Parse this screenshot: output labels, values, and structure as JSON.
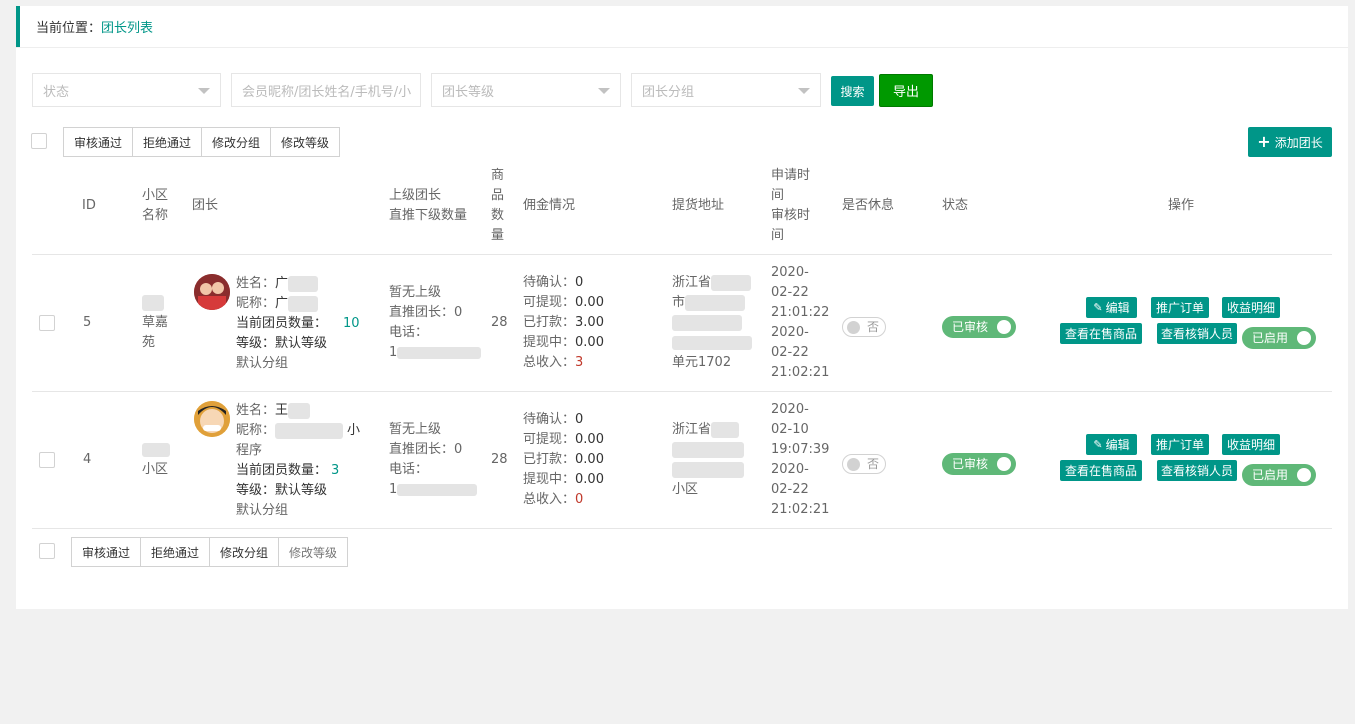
{
  "breadcrumb": {
    "prefix": "当前位置：",
    "current": "团长列表"
  },
  "filters": {
    "status_placeholder": "状态",
    "keyword_placeholder": "会员昵称/团长姓名/手机号/小",
    "level_placeholder": "团长等级",
    "group_placeholder": "团长分组"
  },
  "actions": {
    "search": "搜索",
    "export": "导出",
    "add": "添加团长"
  },
  "batch": [
    "审核通过",
    "拒绝通过",
    "修改分组",
    "修改等级"
  ],
  "headers": {
    "id": "ID",
    "community": [
      "小区",
      "名称"
    ],
    "leader": "团长",
    "superior": [
      "上级团长",
      "直推下级数量"
    ],
    "goods": [
      "商",
      "品",
      "数",
      "量"
    ],
    "commission": "佣金情况",
    "address": "提货地址",
    "time": [
      "申请时",
      "间",
      "审核时",
      "间"
    ],
    "rest": "是否休息",
    "status": "状态",
    "ops": "操作"
  },
  "rows": [
    {
      "id": "5",
      "community": "草嘉苑",
      "name_label": "姓名：",
      "name_value": "广",
      "nick_label": "昵称：",
      "nick_value": "广",
      "member_count_label": "当前团员数量：",
      "member_count": "10",
      "level_label": "等级：",
      "level": "默认等级",
      "group": "默认分组",
      "superior": "暂无上级",
      "direct_label": "直推团长：",
      "direct": "0",
      "phone_label": "电话：",
      "phone": "1",
      "goods": "28",
      "pending_label": "待确认：",
      "pending": "0",
      "withdrawable_label": "可提现：",
      "withdrawable": "0.00",
      "paid_label": "已打款：",
      "paid": "3.00",
      "withdrawing_label": "提现中：",
      "withdrawing": "0.00",
      "total_label": "总收入：",
      "total": "3",
      "address": [
        "浙江省",
        "市",
        "单元1702"
      ],
      "apply_time": [
        "2020-",
        "02-22",
        "21:01:22"
      ],
      "audit_time": [
        "2020-",
        "02-22",
        "21:02:21"
      ],
      "rest": "否",
      "status": "已审核",
      "enabled": "已启用"
    },
    {
      "id": "4",
      "community": "小区",
      "name_label": "姓名：",
      "name_value": "王",
      "nick_label": "昵称：",
      "nick_value": "小",
      "nick_tail": "程序",
      "member_count_label": "当前团员数量：",
      "member_count": "3",
      "level_label": "等级：",
      "level": "默认等级",
      "group": "默认分组",
      "superior": "暂无上级",
      "direct_label": "直推团长：",
      "direct": "0",
      "phone_label": "电话：",
      "phone": "1",
      "goods": "28",
      "pending_label": "待确认：",
      "pending": "0",
      "withdrawable_label": "可提现：",
      "withdrawable": "0.00",
      "paid_label": "已打款：",
      "paid": "0.00",
      "withdrawing_label": "提现中：",
      "withdrawing": "0.00",
      "total_label": "总收入：",
      "total": "0",
      "address": [
        "浙江省",
        "小区"
      ],
      "apply_time": [
        "2020-",
        "02-10",
        "19:07:39"
      ],
      "audit_time": [
        "2020-",
        "02-22",
        "21:02:21"
      ],
      "rest": "否",
      "status": "已审核",
      "enabled": "已启用"
    }
  ],
  "row_ops": {
    "edit": "编辑",
    "orders": "推广订单",
    "income": "收益明细",
    "goods": "查看在售商品",
    "verifiers": "查看核销人员"
  },
  "colors": {
    "accent": "#009688",
    "export": "#009900",
    "switch_on": "#5fb878",
    "total_red": "#c0392b"
  },
  "icons": {
    "edit": "pencil-icon",
    "add": "plus-icon",
    "dropdown": "caret-down-icon"
  }
}
